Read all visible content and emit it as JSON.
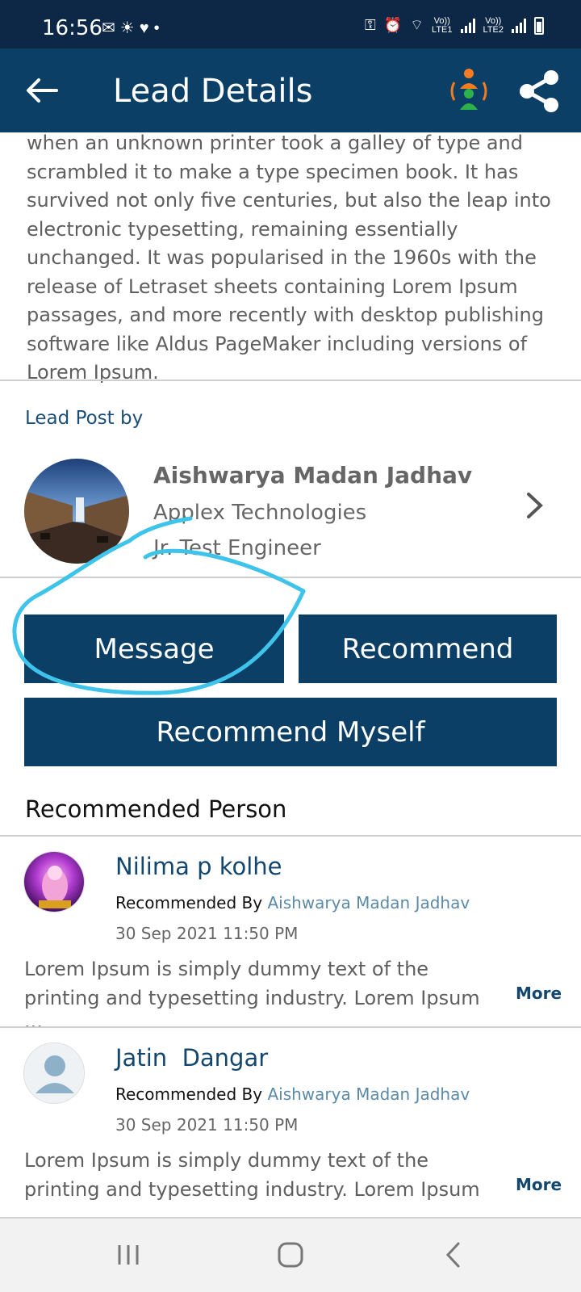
{
  "status_bar": {
    "time": "16:56",
    "net1_top": "Vo))",
    "net1_bottom": "LTE1",
    "net2_top": "Vo))",
    "net2_bottom": "LTE2"
  },
  "header": {
    "title": "Lead Details"
  },
  "description": "when an unknown printer took a galley of type and scrambled it to make a type specimen book. It has survived not only five centuries, but also the leap into electronic typesetting, remaining essentially unchanged. It was popularised in the 1960s with the release of Letraset sheets containing Lorem Ipsum passages, and more recently with desktop publishing software like Aldus PageMaker including versions of Lorem Ipsum.",
  "lead_post": {
    "label": "Lead Post by",
    "name": "Aishwarya Madan Jadhav",
    "company": "Applex Technologies",
    "role": "Jr. Test Engineer"
  },
  "buttons": {
    "message": "Message",
    "recommend": "Recommend",
    "recommend_myself": "Recommend Myself"
  },
  "recommended": {
    "heading": "Recommended Person",
    "items": [
      {
        "name": "Nilima p kolhe",
        "by_label": "Recommended By",
        "by_name": "Aishwarya Madan Jadhav",
        "date": "30 Sep 2021 11:50 PM",
        "text": "Lorem Ipsum is simply dummy text of the printing and typesetting industry. Lorem Ipsum ···",
        "more": "More"
      },
      {
        "name": "Jatin  Dangar",
        "by_label": "Recommended By",
        "by_name": "Aishwarya Madan Jadhav",
        "date": "30 Sep 2021 11:50 PM",
        "text": "Lorem Ipsum is simply dummy text of the printing and typesetting industry. Lorem Ipsum ···",
        "more": "More"
      }
    ]
  },
  "colors": {
    "status_bar": "#0d2747",
    "app_bar": "#0c3f66",
    "button": "#0c3f66",
    "link": "#5b8aa8",
    "annotation": "#3ec3ea"
  },
  "icons": [
    "back-arrow-icon",
    "people-icon",
    "share-icon",
    "chevron-right-icon",
    "user-placeholder-icon"
  ]
}
